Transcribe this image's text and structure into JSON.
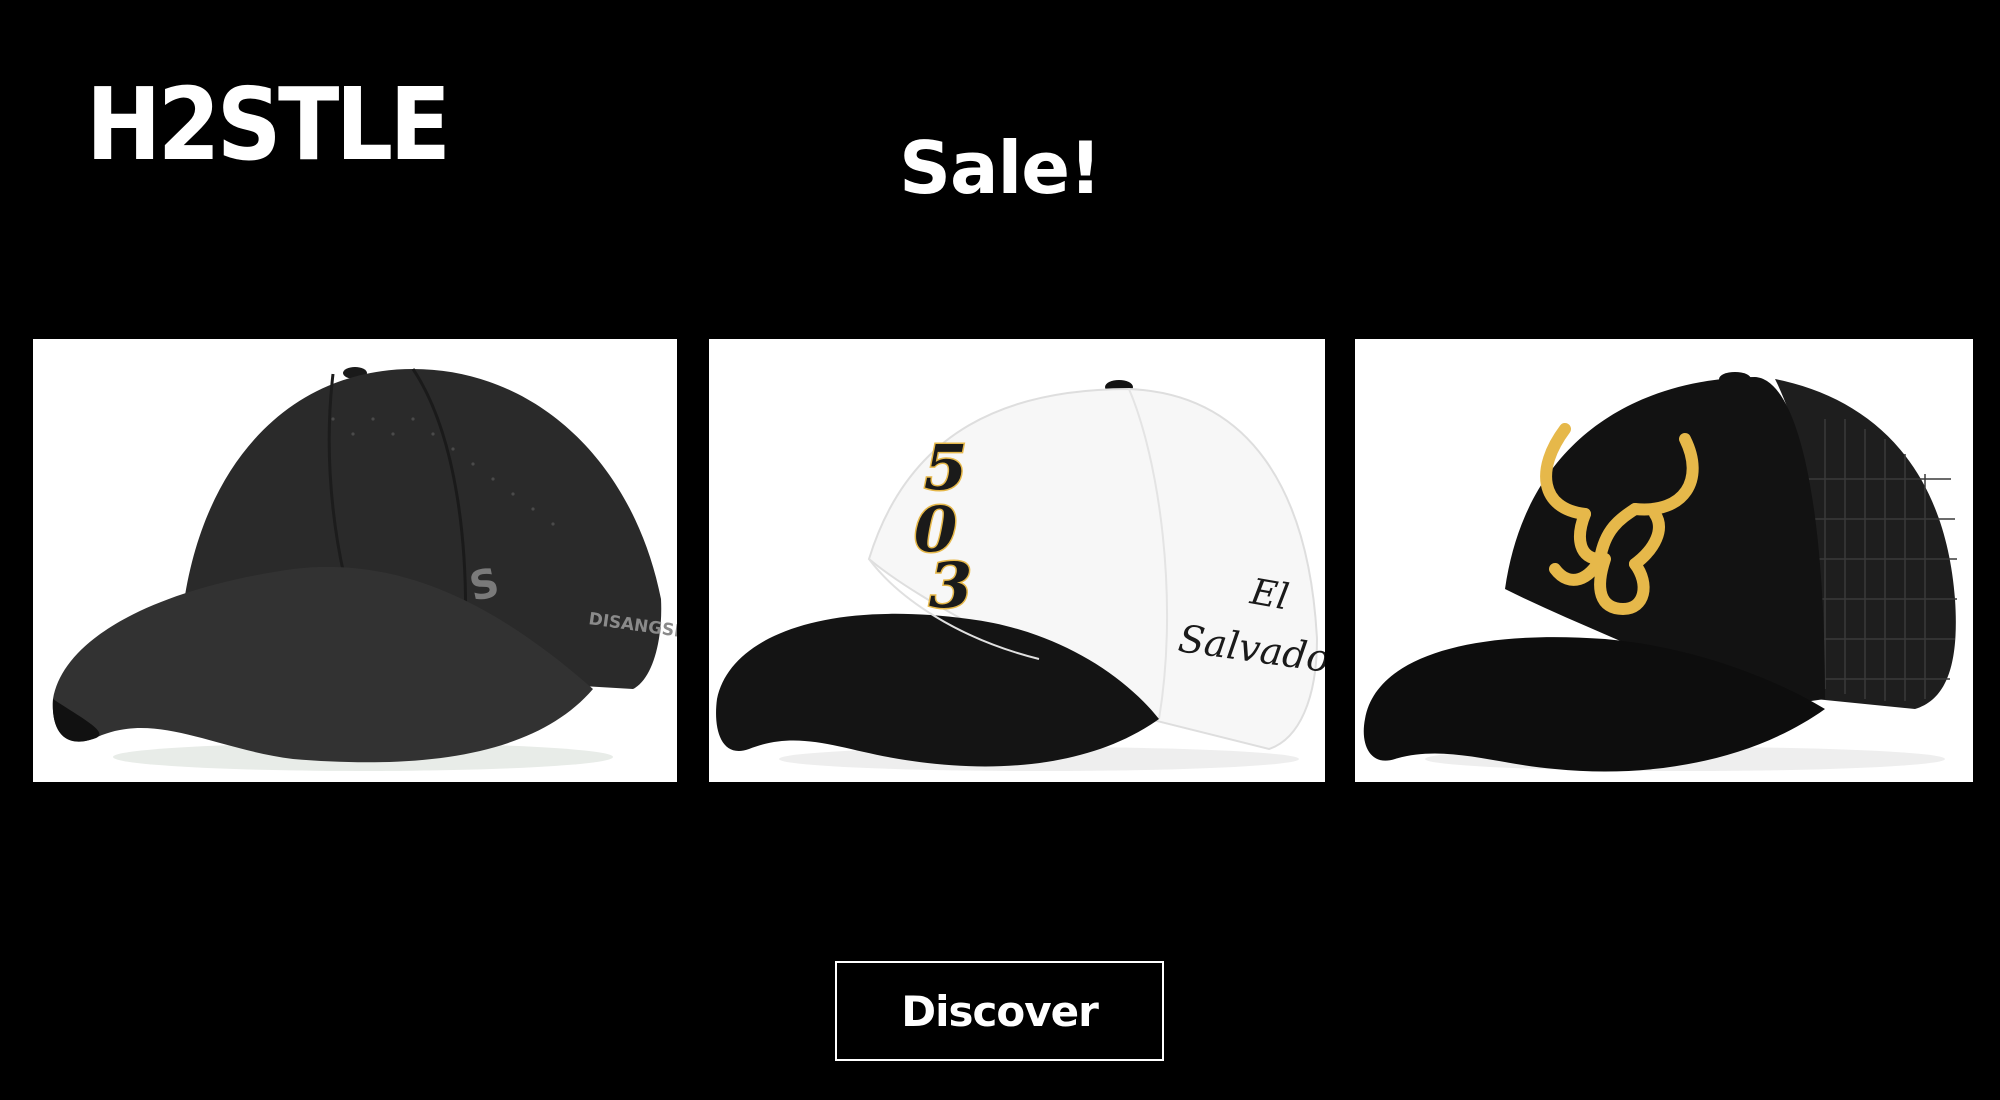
{
  "brand": {
    "name": "H2STLE"
  },
  "headline": {
    "text": "Sale!"
  },
  "products": [
    {
      "image": "black-perforated-baseball-cap",
      "side_text": "DISANGSI",
      "logo_text": "S"
    },
    {
      "image": "white-black-trucker-cap",
      "front_text": "503",
      "side_text": "El Salvador"
    },
    {
      "image": "black-mesh-trucker-cap-gold-bull",
      "logo": "gold-bull-head"
    }
  ],
  "cta": {
    "label": "Discover"
  },
  "colors": {
    "background": "#000000",
    "text": "#ffffff",
    "accent_gold": "#e6b84a"
  }
}
